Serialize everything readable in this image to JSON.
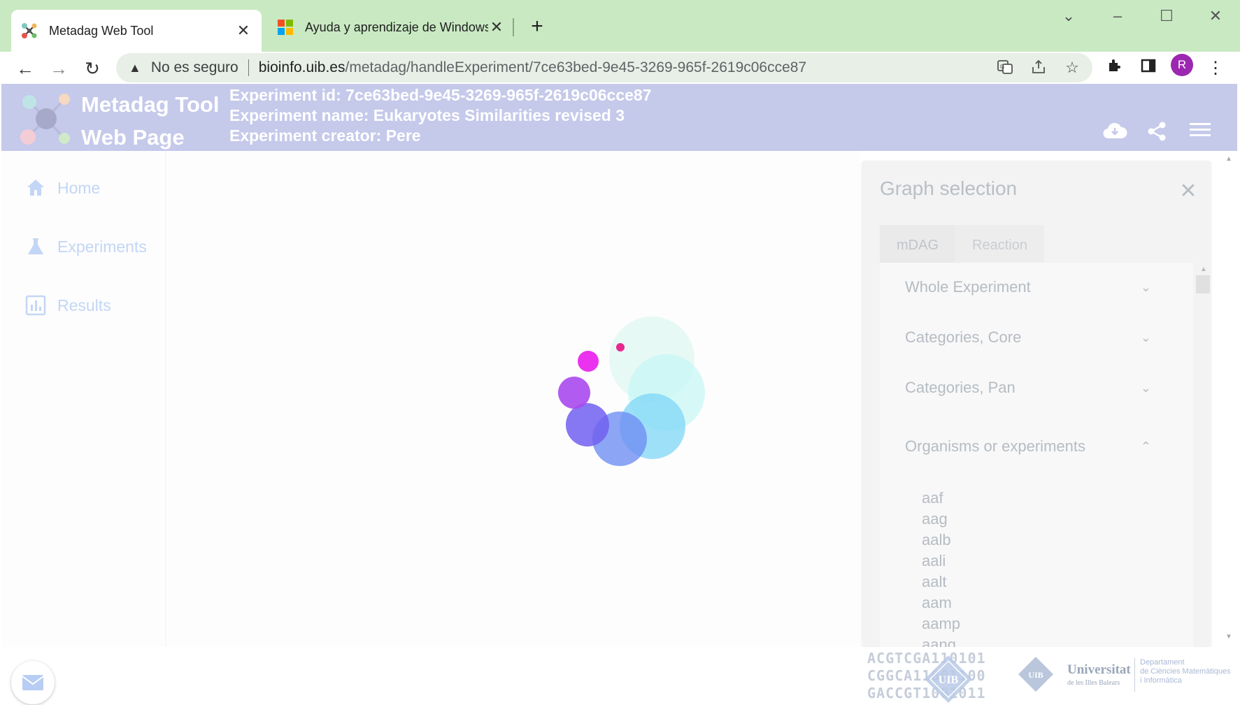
{
  "browser": {
    "tabs": [
      {
        "title": "Metadag Web Tool",
        "active": true
      },
      {
        "title": "Ayuda y aprendizaje de Windows",
        "active": false
      }
    ],
    "address": {
      "security": "No es seguro",
      "host": "bioinfo.uib.es",
      "path": "/metadag/handleExperiment/7ce63bed-9e45-3269-965f-2619c06cce87"
    },
    "profile_initial": "R"
  },
  "header": {
    "app_title_line1": "Metadag Tool",
    "app_title_line2": "Web Page",
    "experiment_id": "Experiment id: 7ce63bed-9e45-3269-965f-2619c06cce87",
    "experiment_name": "Experiment name: Eukaryotes Similarities revised 3",
    "experiment_creator": "Experiment creator: Pere"
  },
  "sidebar": {
    "items": [
      {
        "label": "Home",
        "icon": "home-icon"
      },
      {
        "label": "Experiments",
        "icon": "flask-icon"
      },
      {
        "label": "Results",
        "icon": "bar-chart-icon"
      }
    ]
  },
  "panel": {
    "title": "Graph selection",
    "tabs": [
      "mDAG",
      "Reaction"
    ],
    "sections": [
      {
        "label": "Whole Experiment",
        "expanded": false
      },
      {
        "label": "Categories, Core",
        "expanded": false
      },
      {
        "label": "Categories, Pan",
        "expanded": false
      },
      {
        "label": "Organisms or experiments",
        "expanded": true
      }
    ],
    "organisms": [
      "aaf",
      "aag",
      "aalb",
      "aali",
      "aalt",
      "aam",
      "aamp",
      "aang"
    ]
  },
  "footer": {
    "dna_lines": [
      "ACGTCGA110101",
      "CGGCA11001100",
      "GACCGT1001011"
    ],
    "university_name": "Universitat",
    "university_sub": "de les Illes Balears",
    "department_lines": [
      "Departament",
      "de Ciències Matemàtiques",
      "i Informàtica"
    ],
    "badge_text": "UIB"
  },
  "colors": {
    "header_bg": "#c5c9ea",
    "tab_strip": "#c9e9c3",
    "nav_text": "#c3d6f6"
  }
}
